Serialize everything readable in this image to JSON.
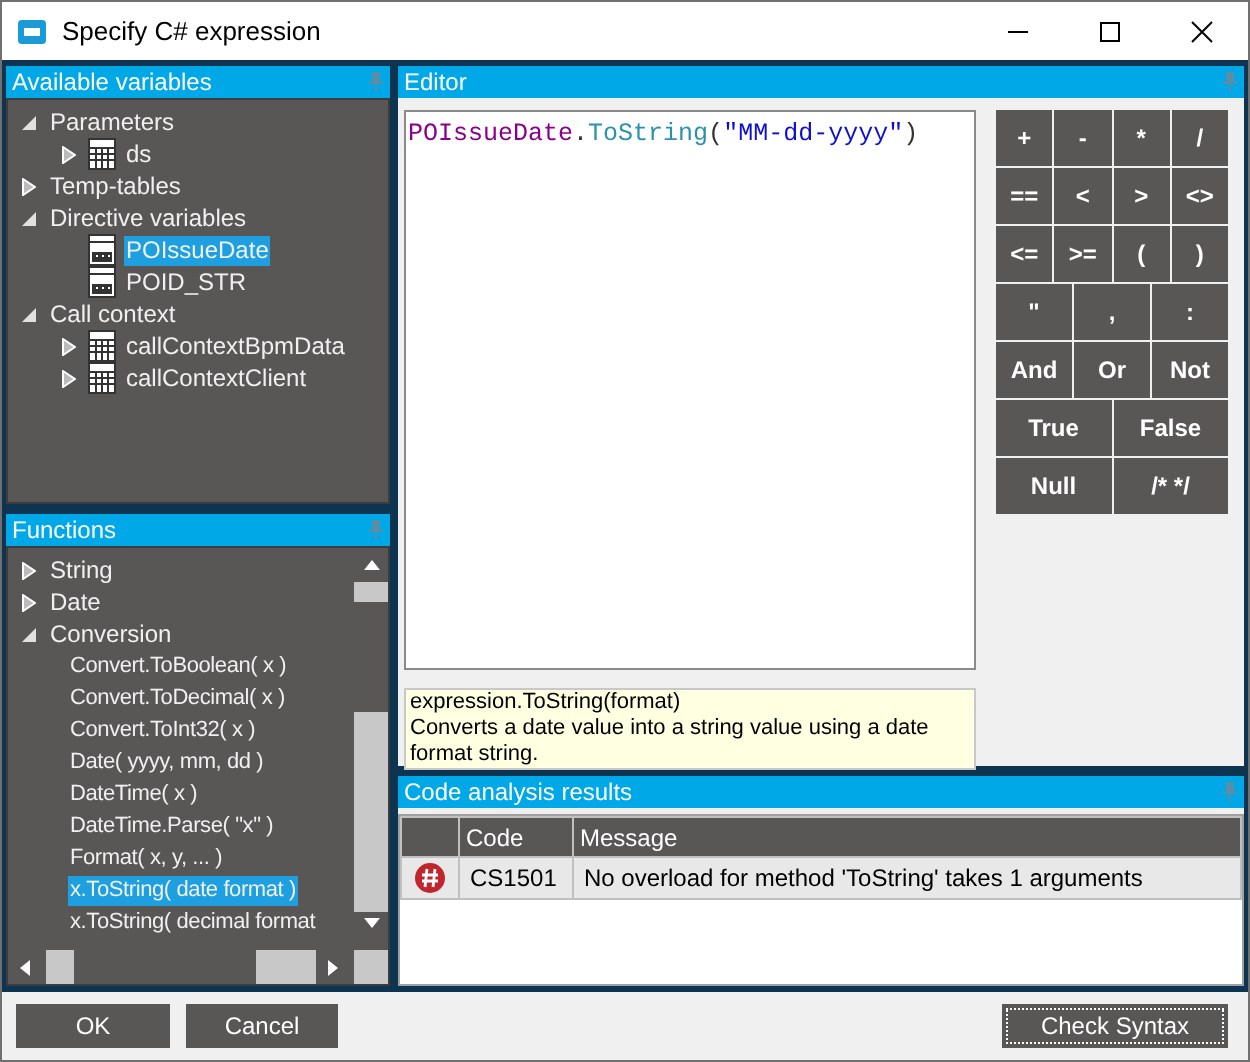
{
  "window": {
    "title": "Specify C# expression"
  },
  "variables": {
    "title": "Available variables",
    "items": [
      {
        "label": "Parameters",
        "kind": "group",
        "expanded": true,
        "selected": false,
        "children": [
          {
            "label": "ds",
            "kind": "table",
            "expanded": false,
            "selected": false
          }
        ]
      },
      {
        "label": "Temp-tables",
        "kind": "group",
        "expanded": false,
        "selected": false
      },
      {
        "label": "Directive variables",
        "kind": "group",
        "expanded": true,
        "selected": false,
        "children": [
          {
            "label": "POIssueDate",
            "kind": "field",
            "selected": true
          },
          {
            "label": "POID_STR",
            "kind": "field",
            "selected": false
          }
        ]
      },
      {
        "label": "Call context",
        "kind": "group",
        "expanded": true,
        "selected": false,
        "children": [
          {
            "label": "callContextBpmData",
            "kind": "table",
            "expanded": false,
            "selected": false
          },
          {
            "label": "callContextClient",
            "kind": "table",
            "expanded": false,
            "selected": false
          }
        ]
      }
    ]
  },
  "functions": {
    "title": "Functions",
    "items": [
      {
        "label": "String",
        "kind": "group",
        "expanded": false,
        "selected": false
      },
      {
        "label": "Date",
        "kind": "group",
        "expanded": false,
        "selected": false
      },
      {
        "label": "Conversion",
        "kind": "group",
        "expanded": true,
        "selected": false,
        "children": [
          {
            "label": "Convert.ToBoolean( x )",
            "kind": "function",
            "selected": false
          },
          {
            "label": "Convert.ToDecimal( x )",
            "kind": "function",
            "selected": false
          },
          {
            "label": "Convert.ToInt32( x )",
            "kind": "function",
            "selected": false
          },
          {
            "label": "Date( yyyy, mm, dd )",
            "kind": "function",
            "selected": false
          },
          {
            "label": "DateTime( x )",
            "kind": "function",
            "selected": false
          },
          {
            "label": "DateTime.Parse( \"x\" )",
            "kind": "function",
            "selected": false
          },
          {
            "label": "Format( x, y, ... )",
            "kind": "function",
            "selected": false
          },
          {
            "label": "x.ToString( date format )",
            "kind": "function",
            "selected": true
          },
          {
            "label": "x.ToString( decimal format",
            "kind": "function",
            "selected": false
          }
        ]
      }
    ]
  },
  "editor": {
    "title": "Editor",
    "code": [
      {
        "text": "POIssueDate",
        "kind": "identifier"
      },
      {
        "text": ".",
        "kind": "punct"
      },
      {
        "text": "ToString",
        "kind": "method"
      },
      {
        "text": "(",
        "kind": "punct"
      },
      {
        "text": "\"MM-dd-yyyy\"",
        "kind": "string"
      },
      {
        "text": ")",
        "kind": "punct"
      }
    ],
    "keypad": [
      [
        "+",
        "-",
        "*",
        "/"
      ],
      [
        "==",
        "<",
        ">",
        "<>"
      ],
      [
        "<=",
        ">=",
        "(",
        ")"
      ],
      [
        "\"",
        ",",
        ":"
      ],
      [
        "And",
        "Or",
        "Not"
      ],
      [
        "True",
        "False"
      ],
      [
        "Null",
        "/* */"
      ]
    ],
    "hint": [
      "expression.ToString(format)",
      "Converts a date value into a string value using a date format string."
    ]
  },
  "analysis": {
    "title": "Code analysis results",
    "columns": [
      "Code",
      "Message"
    ],
    "rows": [
      {
        "kind": "error",
        "code": "CS1501",
        "message": "No overload for method 'ToString' takes 1 arguments"
      }
    ]
  },
  "buttons": {
    "ok": "OK",
    "cancel": "Cancel",
    "check": "Check Syntax"
  }
}
